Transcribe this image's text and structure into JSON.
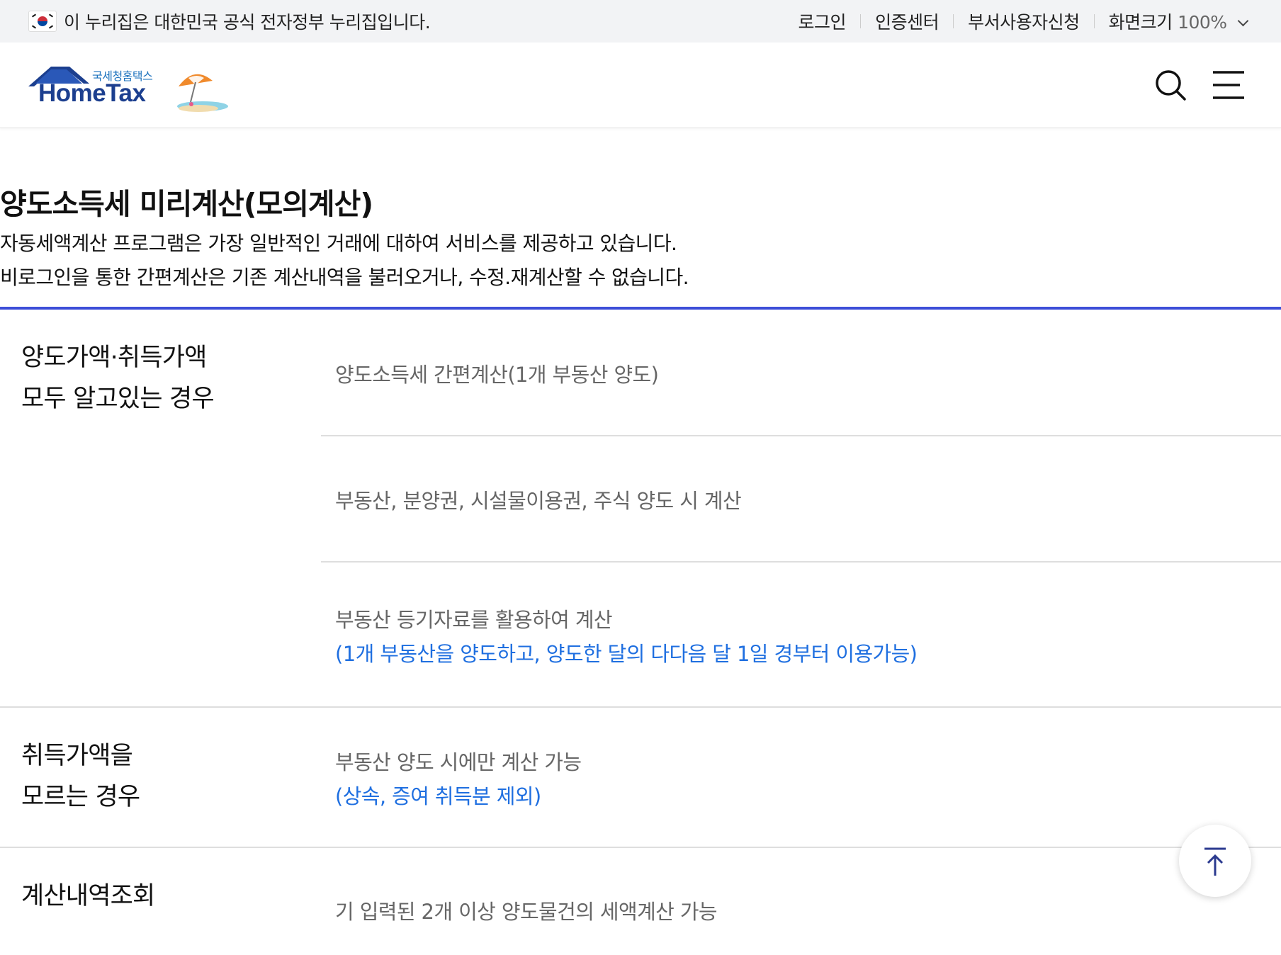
{
  "gov_banner": {
    "notice": "이 누리집은 대한민국 공식 전자정부 누리집입니다.",
    "links": [
      "로그인",
      "인증센터",
      "부서사용자신청"
    ],
    "zoom_label": "화면크기",
    "zoom_value": "100%"
  },
  "header": {
    "logo_sub": "국세청홈택스",
    "logo_main": "HomeTax"
  },
  "page": {
    "title": "양도소득세 미리계산(모의계산)",
    "desc1": "자동세액계산 프로그램은 가장 일반적인 거래에 대하여 서비스를 제공하고 있습니다.",
    "desc2": "비로그인을 통한 간편계산은 기존 계산내역을 불러오거나, 수정.재계산할 수 없습니다."
  },
  "sections": [
    {
      "label_line1": "양도가액·취득가액",
      "label_line2": "모두 알고있는 경우",
      "items": [
        {
          "text": "양도소득세 간편계산(1개 부동산 양도)"
        },
        {
          "text": "부동산, 분양권, 시설물이용권, 주식 양도 시 계산"
        },
        {
          "text": "부동산 등기자료를 활용하여 계산",
          "note": "(1개 부동산을 양도하고, 양도한 달의 다다음 달 1일 경부터 이용가능)"
        }
      ]
    },
    {
      "label_line1": "취득가액을",
      "label_line2": "모르는 경우",
      "items": [
        {
          "text": "부동산 양도 시에만 계산 가능",
          "note": "(상속, 증여 취득분 제외)"
        }
      ]
    },
    {
      "label_line1": "계산내역조회",
      "items": [
        {
          "text": "기 입력된 2개 이상 양도물건의 세액계산 가능"
        }
      ]
    }
  ],
  "colors": {
    "accent": "#3d4ed8",
    "note": "#1f6fe0",
    "logo": "#1c3f8f"
  },
  "icons": [
    "korea-flag-icon",
    "chevron-down-icon",
    "search-icon",
    "menu-icon",
    "arrow-up-icon"
  ]
}
